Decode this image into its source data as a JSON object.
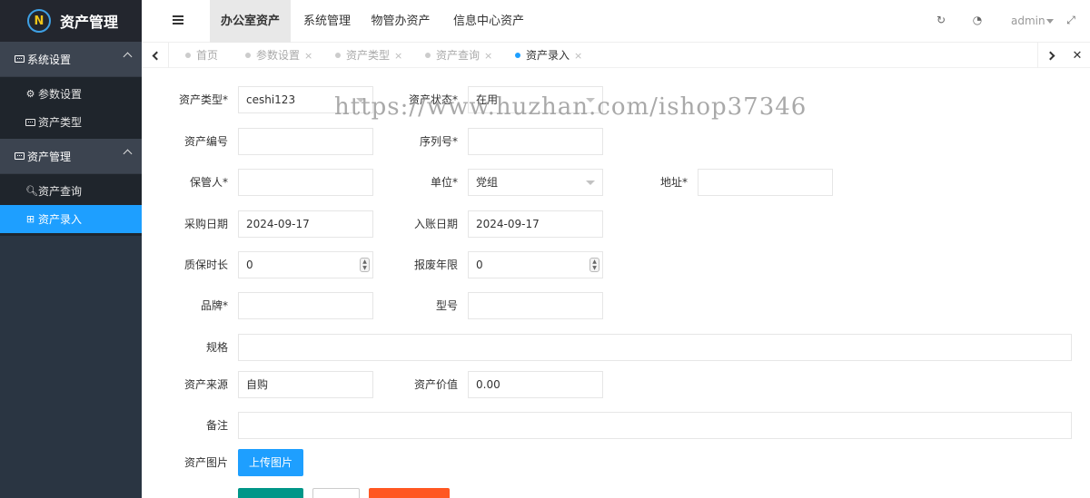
{
  "app": {
    "title": "资产管理",
    "logo_mark": "N"
  },
  "sidebar": {
    "groups": [
      {
        "label": "系统设置",
        "items": [
          {
            "label": "参数设置"
          },
          {
            "label": "资产类型"
          }
        ]
      },
      {
        "label": "资产管理",
        "items": [
          {
            "label": "资产查询"
          },
          {
            "label": "资产录入"
          }
        ]
      }
    ]
  },
  "header": {
    "tabs": [
      {
        "label": "办公室资产"
      },
      {
        "label": "系统管理"
      },
      {
        "label": "物管办资产"
      },
      {
        "label": "信息中心资产"
      }
    ],
    "user": "admin"
  },
  "page_tabs": [
    {
      "label": "首页"
    },
    {
      "label": "参数设置",
      "close": "×"
    },
    {
      "label": "资产类型",
      "close": "×"
    },
    {
      "label": "资产查询",
      "close": "×"
    },
    {
      "label": "资产录入",
      "close": "×"
    }
  ],
  "form": {
    "asset_type": {
      "label": "资产类型*",
      "value": "ceshi123"
    },
    "asset_status": {
      "label": "资产状态*",
      "value": "在用"
    },
    "asset_no": {
      "label": "资产编号",
      "value": ""
    },
    "serial_no": {
      "label": "序列号*",
      "value": ""
    },
    "custodian": {
      "label": "保管人*",
      "value": ""
    },
    "unit": {
      "label": "单位*",
      "value": "党组"
    },
    "address": {
      "label": "地址*",
      "value": ""
    },
    "purchase_date": {
      "label": "采购日期",
      "value": "2024-09-17"
    },
    "entry_date": {
      "label": "入账日期",
      "value": "2024-09-17"
    },
    "warranty": {
      "label": "质保时长",
      "value": "0"
    },
    "scrap_years": {
      "label": "报废年限",
      "value": "0"
    },
    "brand": {
      "label": "品牌*",
      "value": ""
    },
    "model": {
      "label": "型号",
      "value": ""
    },
    "spec": {
      "label": "规格",
      "value": ""
    },
    "source": {
      "label": "资产来源",
      "value": "自购"
    },
    "value": {
      "label": "资产价值",
      "value": "0.00"
    },
    "remark": {
      "label": "备注",
      "value": ""
    },
    "image": {
      "label": "资产图片",
      "upload_label": "上传图片"
    }
  },
  "watermark": "https://www.huzhan.com/ishop37346",
  "colors": {
    "accent": "#1e9fff",
    "sidebar": "#2a3542",
    "green": "#009688",
    "orange": "#ff5722"
  }
}
